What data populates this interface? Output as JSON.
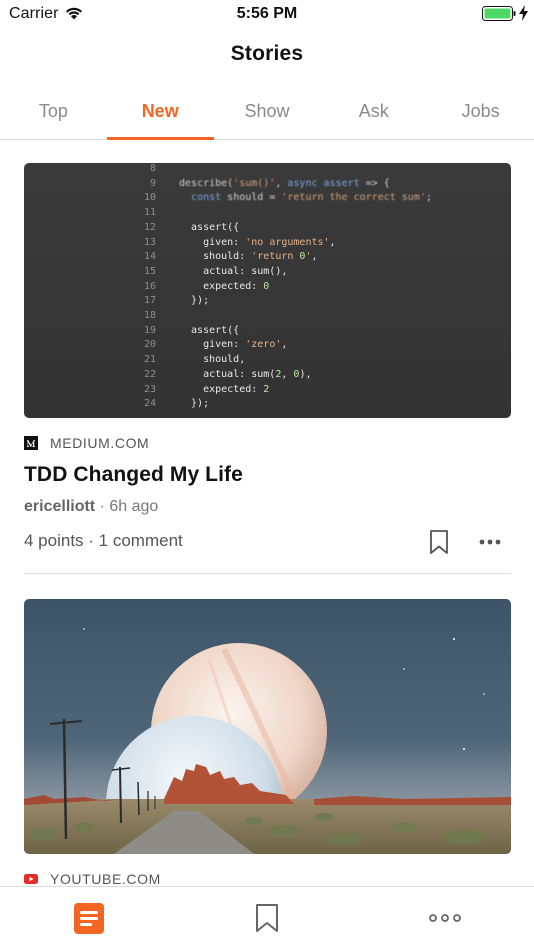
{
  "status_bar": {
    "carrier": "Carrier",
    "time": "5:56 PM",
    "battery_color": "#4cd964"
  },
  "nav": {
    "title": "Stories"
  },
  "tabs": [
    {
      "label": "Top",
      "active": false
    },
    {
      "label": "New",
      "active": true
    },
    {
      "label": "Show",
      "active": false
    },
    {
      "label": "Ask",
      "active": false
    },
    {
      "label": "Jobs",
      "active": false
    }
  ],
  "accent_color": "#f26522",
  "stories": [
    {
      "source": "MEDIUM.COM",
      "source_icon": "medium-logo-icon",
      "title": "TDD Changed My Life",
      "author": "ericelliott",
      "time": "6h ago",
      "points": "4 points",
      "comments": "1 comment",
      "image": "code-screenshot",
      "code": [
        {
          "ln": "8",
          "text": ""
        },
        {
          "ln": "9",
          "text": "describe('sum()', async assert => {"
        },
        {
          "ln": "10",
          "text": "  const should = 'return the correct sum';"
        },
        {
          "ln": "11",
          "text": ""
        },
        {
          "ln": "12",
          "text": "  assert({"
        },
        {
          "ln": "13",
          "text": "    given: 'no arguments',"
        },
        {
          "ln": "14",
          "text": "    should: 'return 0',"
        },
        {
          "ln": "15",
          "text": "    actual: sum(),"
        },
        {
          "ln": "16",
          "text": "    expected: 0"
        },
        {
          "ln": "17",
          "text": "  });"
        },
        {
          "ln": "18",
          "text": ""
        },
        {
          "ln": "19",
          "text": "  assert({"
        },
        {
          "ln": "20",
          "text": "    given: 'zero',"
        },
        {
          "ln": "21",
          "text": "    should,"
        },
        {
          "ln": "22",
          "text": "    actual: sum(2, 0),"
        },
        {
          "ln": "23",
          "text": "    expected: 2"
        },
        {
          "ln": "24",
          "text": "  });"
        }
      ]
    },
    {
      "source": "YOUTUBE.COM",
      "source_icon": "youtube-logo-icon",
      "image": "desert-planets-scene"
    }
  ],
  "tabbar": [
    {
      "icon": "stories-icon",
      "active": true
    },
    {
      "icon": "bookmark-icon",
      "active": false
    },
    {
      "icon": "more-icon",
      "active": false
    }
  ]
}
